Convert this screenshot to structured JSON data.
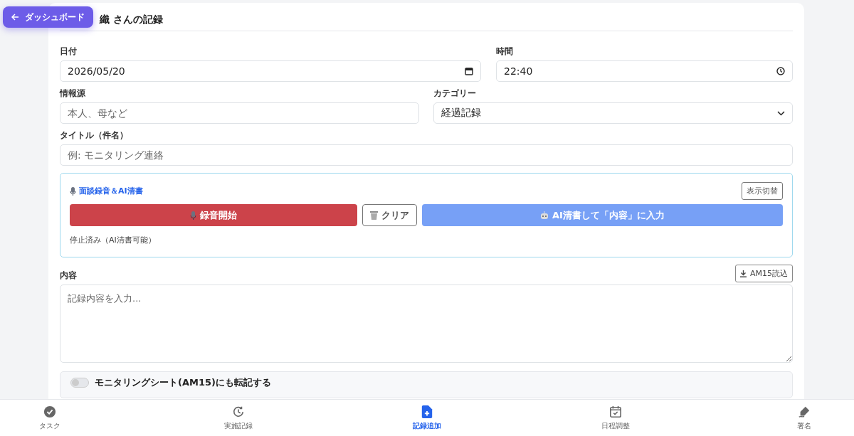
{
  "back_button": {
    "label": "ダッシュボード"
  },
  "page_title": "織 さんの記録",
  "form": {
    "date": {
      "label": "日付",
      "value": "2026/05/20"
    },
    "time": {
      "label": "時間",
      "value": "22:40"
    },
    "source": {
      "label": "情報源",
      "placeholder": "本人、母など"
    },
    "category": {
      "label": "カテゴリー",
      "value": "経過記録"
    },
    "title": {
      "label": "タイトル（件名）",
      "placeholder": "例: モニタリング連絡"
    }
  },
  "recorder": {
    "heading": "面談録音＆AI清書",
    "toggle_button": "表示切替",
    "record_button": "録音開始",
    "clear_button": "クリア",
    "ai_button": "AI清書して「内容」に入力",
    "status": "停止済み（AI清書可能）"
  },
  "content": {
    "label": "内容",
    "import_button": "AM15読込",
    "placeholder": "記録内容を入力..."
  },
  "transfer": {
    "label": "モニタリングシート(AM15)にも転記する",
    "on": false
  },
  "bottom_nav": [
    {
      "kind": "task",
      "label": "タスク",
      "selected": false
    },
    {
      "kind": "history",
      "label": "実施記録",
      "selected": false
    },
    {
      "kind": "add",
      "label": "記録追加",
      "selected": true
    },
    {
      "kind": "calendar",
      "label": "日程調整",
      "selected": false
    },
    {
      "kind": "sign",
      "label": "署名",
      "selected": false
    }
  ]
}
